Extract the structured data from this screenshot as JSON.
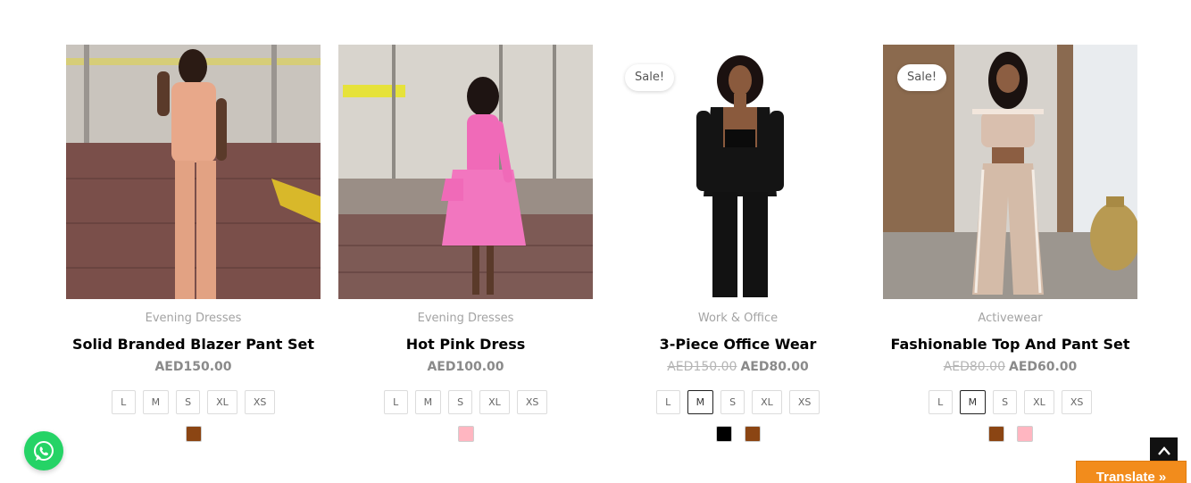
{
  "products": [
    {
      "image_alt": "Solid Branded Blazer Pant Set",
      "sale_badge": "",
      "category": "Evening Dresses",
      "title": "Solid Branded Blazer Pant Set",
      "price_old": "",
      "price": "AED150.00",
      "sizes": [
        "L",
        "M",
        "S",
        "XL",
        "XS"
      ],
      "selected_size": "",
      "swatches": [
        "#8b4513"
      ]
    },
    {
      "image_alt": "Hot Pink Dress",
      "sale_badge": "",
      "category": "Evening Dresses",
      "title": "Hot Pink Dress",
      "price_old": "",
      "price": "AED100.00",
      "sizes": [
        "L",
        "M",
        "S",
        "XL",
        "XS"
      ],
      "selected_size": "",
      "swatches": [
        "#ffb6c1"
      ]
    },
    {
      "image_alt": "3-Piece Office Wear",
      "sale_badge": "Sale!",
      "category": "Work & Office",
      "title": "3-Piece Office Wear",
      "price_old": "AED150.00",
      "price": "AED80.00",
      "sizes": [
        "L",
        "M",
        "S",
        "XL",
        "XS"
      ],
      "selected_size": "M",
      "swatches": [
        "#000000",
        "#8b4513"
      ]
    },
    {
      "image_alt": "Fashionable Top And Pant Set",
      "sale_badge": "Sale!",
      "category": "Activewear",
      "title": "Fashionable Top And Pant Set",
      "price_old": "AED80.00",
      "price": "AED60.00",
      "sizes": [
        "L",
        "M",
        "S",
        "XL",
        "XS"
      ],
      "selected_size": "M",
      "swatches": [
        "#8b4513",
        "#ffb6c1"
      ]
    }
  ],
  "widgets": {
    "whatsapp_icon": "whatsapp-icon",
    "scroll_top_icon": "chevron-up-icon",
    "translate_label": "Translate »"
  },
  "colors": {
    "accent_translate": "#f28c1c",
    "whatsapp_green": "#25d366"
  }
}
